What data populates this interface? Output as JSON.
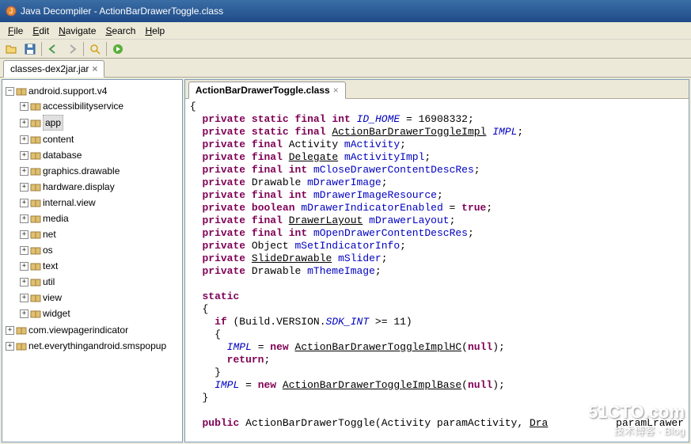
{
  "title": "Java Decompiler - ActionBarDrawerToggle.class",
  "menu": {
    "file": "File",
    "edit": "Edit",
    "navigate": "Navigate",
    "search": "Search",
    "help": "Help"
  },
  "project_tab": {
    "label": "classes-dex2jar.jar",
    "close": "×"
  },
  "tree": {
    "root": "android.support.v4",
    "items": [
      {
        "label": "accessibilityservice",
        "toggle": "+"
      },
      {
        "label": "app",
        "toggle": "+",
        "selected": true
      },
      {
        "label": "content",
        "toggle": "+"
      },
      {
        "label": "database",
        "toggle": "+"
      },
      {
        "label": "graphics.drawable",
        "toggle": "+"
      },
      {
        "label": "hardware.display",
        "toggle": "+"
      },
      {
        "label": "internal.view",
        "toggle": "+"
      },
      {
        "label": "media",
        "toggle": "+"
      },
      {
        "label": "net",
        "toggle": "+"
      },
      {
        "label": "os",
        "toggle": "+"
      },
      {
        "label": "text",
        "toggle": "+"
      },
      {
        "label": "util",
        "toggle": "+"
      },
      {
        "label": "view",
        "toggle": "+"
      },
      {
        "label": "widget",
        "toggle": "+"
      }
    ],
    "extra": [
      {
        "label": "com.viewpagerindicator"
      },
      {
        "label": "net.everythingandroid.smspopup"
      }
    ]
  },
  "editor_tab": {
    "label": "ActionBarDrawerToggle.class",
    "close": "×"
  },
  "code": {
    "l0": "{",
    "l1a": "private",
    "l1b": "static",
    "l1c": "final",
    "l1d": "int",
    "l1e": "ID_HOME",
    "l1f": " = 16908332;",
    "l2a": "private",
    "l2b": "static",
    "l2c": "final",
    "l2d": "ActionBarDrawerToggleImpl",
    "l2e": "IMPL",
    "l2f": ";",
    "l3a": "private",
    "l3b": "final",
    "l3c": " Activity ",
    "l3d": "mActivity",
    "l3e": ";",
    "l4a": "private",
    "l4b": "final",
    "l4c": "Delegate",
    "l4d": "mActivityImpl",
    "l4e": ";",
    "l5a": "private",
    "l5b": "final",
    "l5c": "int",
    "l5d": "mCloseDrawerContentDescRes",
    "l5e": ";",
    "l6a": "private",
    "l6b": " Drawable ",
    "l6c": "mDrawerImage",
    "l6d": ";",
    "l7a": "private",
    "l7b": "final",
    "l7c": "int",
    "l7d": "mDrawerImageResource",
    "l7e": ";",
    "l8a": "private",
    "l8b": "boolean",
    "l8c": "mDrawerIndicatorEnabled",
    "l8d": " = ",
    "l8e": "true",
    "l8f": ";",
    "l9a": "private",
    "l9b": "final",
    "l9c": "DrawerLayout",
    "l9d": "mDrawerLayout",
    "l9e": ";",
    "l10a": "private",
    "l10b": "final",
    "l10c": "int",
    "l10d": "mOpenDrawerContentDescRes",
    "l10e": ";",
    "l11a": "private",
    "l11b": " Object ",
    "l11c": "mSetIndicatorInfo",
    "l11d": ";",
    "l12a": "private",
    "l12b": "SlideDrawable",
    "l12c": "mSlider",
    "l12d": ";",
    "l13a": "private",
    "l13b": " Drawable ",
    "l13c": "mThemeImage",
    "l13d": ";",
    "s1": "static",
    "s2": "  {",
    "s3": "if",
    "s4": " (Build.VERSION.",
    "s5": "SDK_INT",
    "s6": " >= 11)",
    "s7": "    {",
    "s8": "IMPL",
    "s9": " = ",
    "s10": "new",
    "s11": "ActionBarDrawerToggleImplHC",
    "s12": "(",
    "s13": "null",
    "s14": ");",
    "s15": "return",
    "s16": ";",
    "s17": "    }",
    "s18": "IMPL",
    "s19": " = ",
    "s20": "new",
    "s21": "ActionBarDrawerToggleImplBase",
    "s22": "(",
    "s23": "null",
    "s24": ");",
    "s25": "  }",
    "p1": "public",
    "p2": " ActionBarDrawerToggle(Activity paramActivity, ",
    "p3": "Dra",
    "p4": "paramLrawer"
  },
  "watermark": {
    "big": "51CTO.com",
    "small": "技术博客 · Blog"
  }
}
